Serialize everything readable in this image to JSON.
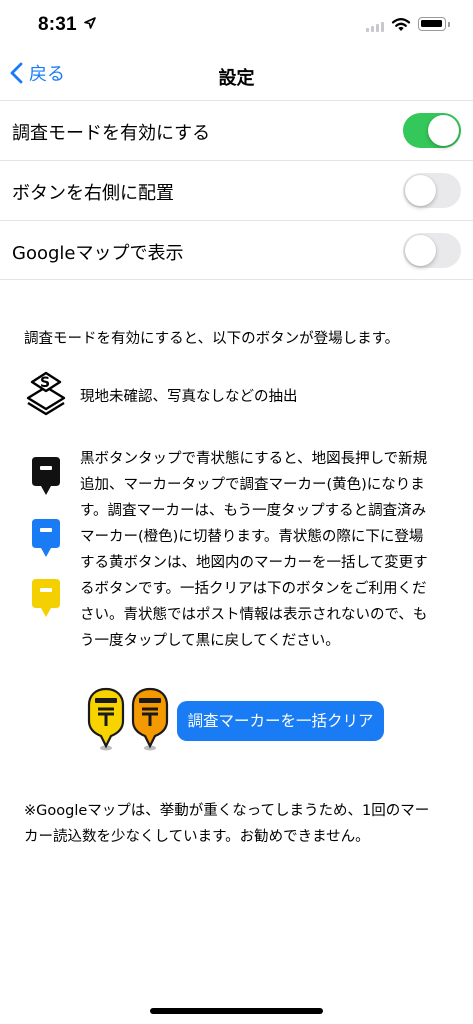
{
  "status_bar": {
    "time": "8:31"
  },
  "nav": {
    "back_label": "戻る",
    "title": "設定"
  },
  "settings": [
    {
      "label": "調査モードを有効にする",
      "on": true
    },
    {
      "label": "ボタンを右側に配置",
      "on": false
    },
    {
      "label": "Googleマップで表示",
      "on": false
    }
  ],
  "description": {
    "intro": "調査モードを有効にすると、以下のボタンが登場します。",
    "feature1": "現地未確認、写真なしなどの抽出",
    "body_lines": [
      "黒ボタンタップで青状態にすると、地図長押しで新規",
      "追加、マーカータップで調査マーカー(黄色)になりま",
      "す。調査マーカーは、もう一度タップすると調査済み",
      "マーカー(橙色)に切替ります。青状態の際に下に登場",
      "する黄ボタンは、地図内のマーカーを一括して変更す",
      "るボタンです。一括クリアは下のボタンをご利用くだ",
      "さい。青状態ではポスト情報は表示されないので、も",
      "う一度タップして黒に戻してください。"
    ]
  },
  "clear_button": {
    "label": "調査マーカーを一括クリア"
  },
  "note_lines": [
    "※Googleマップは、挙動が重くなってしまうため、1回のマー",
    "カー読込数を少なくしています。お勧めできません。"
  ],
  "colors": {
    "accent": "#1a7cf5",
    "toggle_on": "#34c759",
    "marker_black": "#111111",
    "marker_blue": "#1a7cf5",
    "marker_yellow": "#f5d000",
    "pin_yellow": "#f7d400",
    "pin_orange": "#f49a00"
  }
}
